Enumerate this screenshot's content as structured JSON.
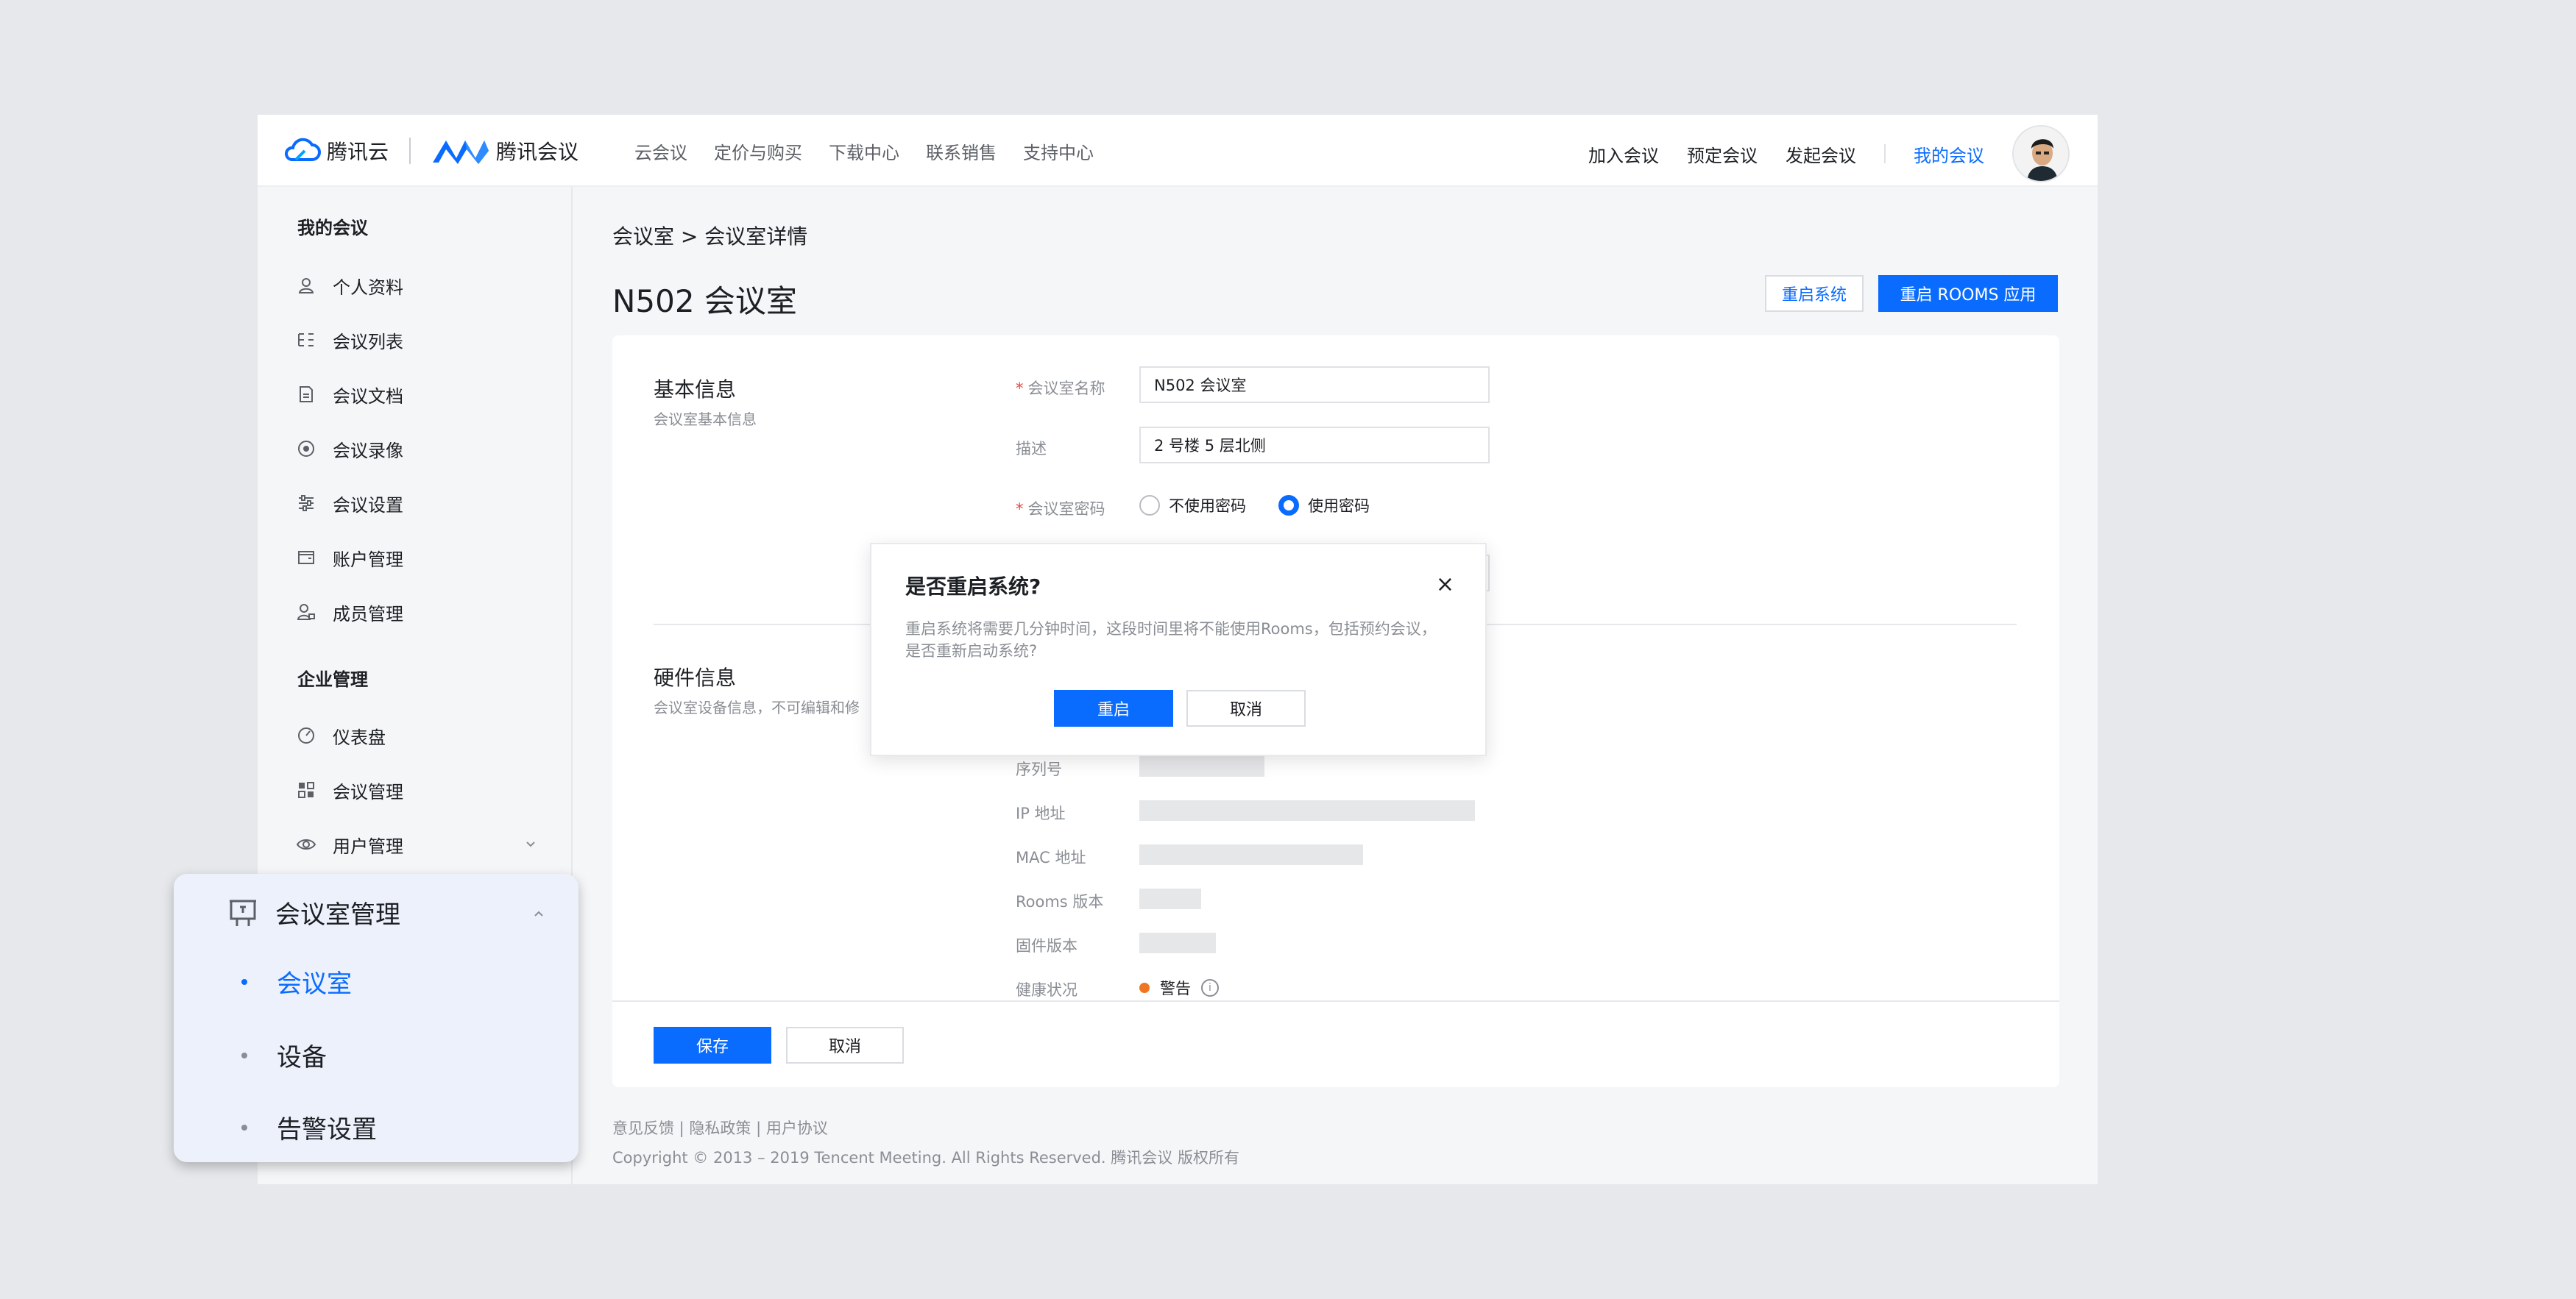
{
  "brand": {
    "cloud_name": "腾讯云",
    "meeting_name": "腾讯会议"
  },
  "nav": [
    "云会议",
    "定价与购买",
    "下载中心",
    "联系销售",
    "支持中心"
  ],
  "top_actions": {
    "join": "加入会议",
    "schedule": "预定会议",
    "start": "发起会议",
    "mine": "我的会议"
  },
  "sidebar": {
    "my_meeting_heading": "我的会议",
    "my_items": [
      "个人资料",
      "会议列表",
      "会议文档",
      "会议录像",
      "会议设置",
      "账户管理",
      "成员管理"
    ],
    "enterprise_heading": "企业管理",
    "enterprise_items": [
      "仪表盘",
      "会议管理",
      "用户管理"
    ]
  },
  "breadcrumb": "会议室 > 会议室详情",
  "page_title": "N502 会议室",
  "header_buttons": {
    "restart_system": "重启系统",
    "restart_rooms": "重启 ROOMS 应用"
  },
  "basic": {
    "title": "基本信息",
    "subtitle": "会议室基本信息",
    "name_label": "会议室名称",
    "name_value": "N502 会议室",
    "desc_label": "描述",
    "desc_value": "2 号楼 5 层北侧",
    "password_label": "会议室密码",
    "no_password": "不使用密码",
    "use_password": "使用密码"
  },
  "hardware": {
    "title": "硬件信息",
    "subtitle": "会议室设备信息，不可编辑和修",
    "serial_label": "序列号",
    "ip_label": "IP 地址",
    "mac_label": "MAC 地址",
    "rooms_version_label": "Rooms 版本",
    "firmware_label": "固件版本",
    "health_label": "健康状况",
    "health_value": "警告",
    "health_color": "#f07523"
  },
  "footer_buttons": {
    "save": "保存",
    "cancel": "取消"
  },
  "footer": {
    "links": "意见反馈 | 隐私政策 | 用户协议",
    "copyright": "Copyright © 2013 – 2019 Tencent Meeting. All Rights Reserved.  腾讯会议 版权所有"
  },
  "modal": {
    "title": "是否重启系统?",
    "body": "重启系统将需要几分钟时间，这段时间里将不能使用Rooms，包括预约会议，是否重新启动系统?",
    "confirm": "重启",
    "cancel": "取消",
    "close": "×"
  },
  "popover": {
    "heading": "会议室管理",
    "items": [
      "会议室",
      "设备",
      "告警设置"
    ],
    "active_index": 0
  },
  "colors": {
    "accent": "#0a6cff",
    "required": "#e54545",
    "warning": "#f07523"
  }
}
